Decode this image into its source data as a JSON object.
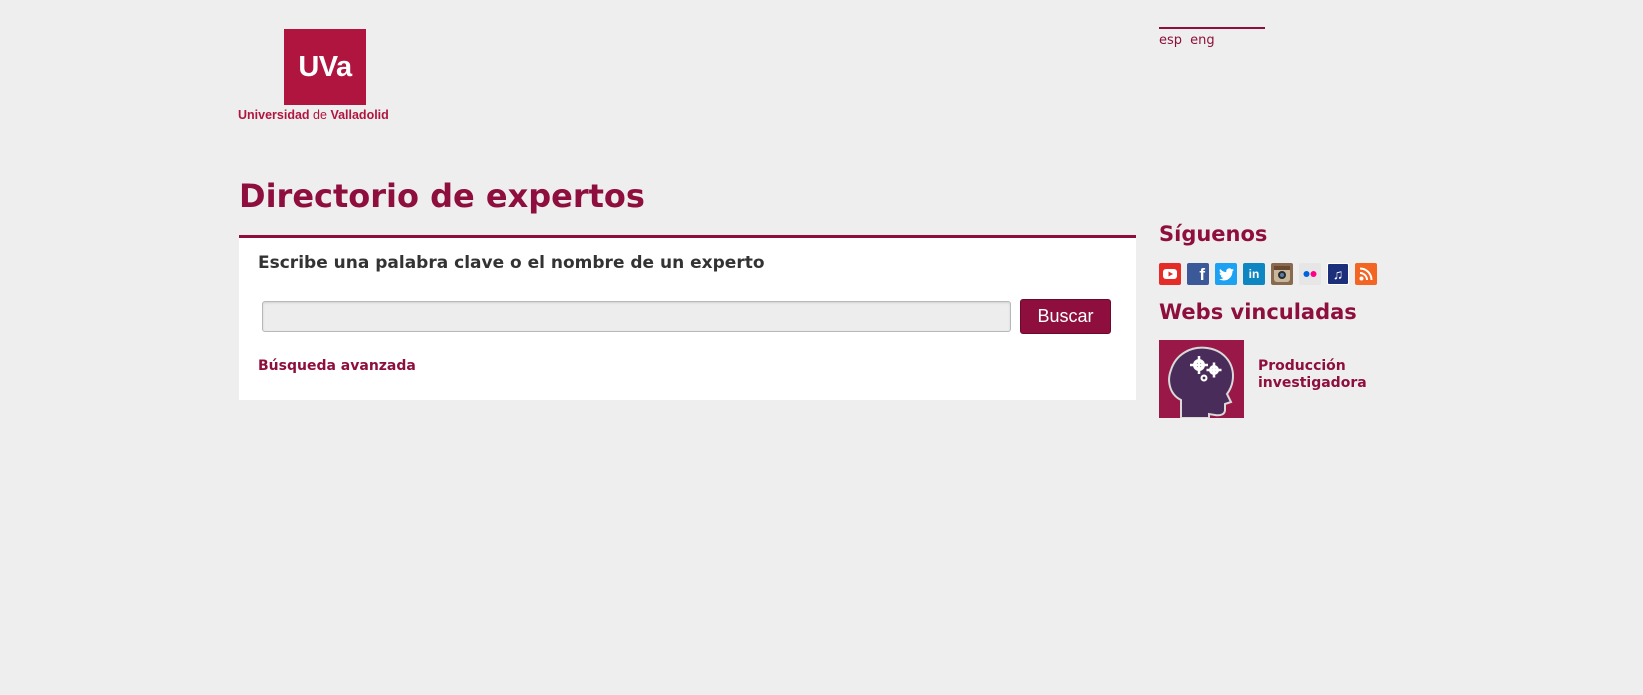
{
  "logo": {
    "mark": "UVa",
    "name_part1": "Universidad",
    "name_de": "de",
    "name_part2": "Valladolid"
  },
  "lang": {
    "items": [
      {
        "label": "esp"
      },
      {
        "label": "eng"
      }
    ]
  },
  "page_title": "Directorio de expertos",
  "search": {
    "heading": "Escribe una palabra clave o el nombre de un experto",
    "input_value": "",
    "placeholder": "",
    "button_label": "Buscar",
    "advanced_link": "Búsqueda avanzada"
  },
  "sidebar": {
    "follow_heading": "Síguenos",
    "social": [
      {
        "name": "youtube-icon",
        "color": "#e52d27"
      },
      {
        "name": "facebook-icon",
        "color": "#3b5998"
      },
      {
        "name": "twitter-icon",
        "color": "#1da1f2"
      },
      {
        "name": "linkedin-icon",
        "color": "#0e86c2"
      },
      {
        "name": "instagram-icon",
        "color": "#8a6a4f"
      },
      {
        "name": "flickr-icon",
        "color": "#e6e6e6"
      },
      {
        "name": "music-icon",
        "color": "#1b2f7a"
      },
      {
        "name": "rss-icon",
        "color": "#f26522"
      }
    ],
    "linked_heading": "Webs vinculadas",
    "linked": [
      {
        "label": "Producción investigadora"
      }
    ]
  },
  "colors": {
    "brand": "#8e0f3d",
    "logo": "#b0153f",
    "background": "#eeeeee"
  }
}
